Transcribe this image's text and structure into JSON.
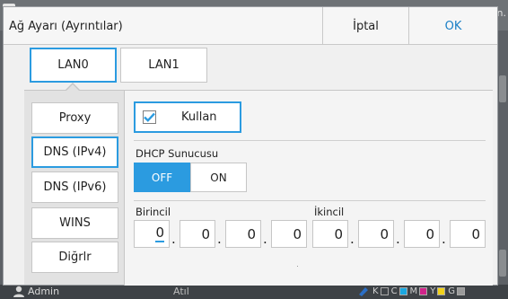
{
  "background": {
    "corner_text": "n.",
    "status": {
      "user": "Admin",
      "mode": "Atıl",
      "ink": [
        "K",
        "C",
        "M",
        "Y",
        "G"
      ],
      "ink_colors": [
        "#3a3a3a",
        "#1aa7e0",
        "#d0248a",
        "#f2d21a",
        "#9a9a9a"
      ]
    }
  },
  "dialog": {
    "title": "Ağ Ayarı (Ayrıntılar)",
    "cancel_label": "İptal",
    "ok_label": "OK",
    "accent_color": "#2b9be0"
  },
  "tabs": [
    {
      "label": "LAN0",
      "selected": true
    },
    {
      "label": "LAN1",
      "selected": false
    }
  ],
  "sidebar": {
    "items": [
      {
        "label": "Proxy",
        "selected": false
      },
      {
        "label": "DNS (IPv4)",
        "selected": true
      },
      {
        "label": "DNS (IPv6)",
        "selected": false
      },
      {
        "label": "WINS",
        "selected": false
      },
      {
        "label": "Diğrlr",
        "selected": false
      }
    ]
  },
  "content": {
    "use_checkbox": {
      "label": "Kullan",
      "checked": true
    },
    "dhcp": {
      "label": "DHCP Sunucusu",
      "off_label": "OFF",
      "on_label": "ON",
      "value": "OFF"
    },
    "primary": {
      "label": "Birincil",
      "octets": [
        "0",
        "0",
        "0",
        "0"
      ]
    },
    "secondary": {
      "label": "İkincil",
      "octets": [
        "0",
        "0",
        "0",
        "0"
      ]
    }
  }
}
